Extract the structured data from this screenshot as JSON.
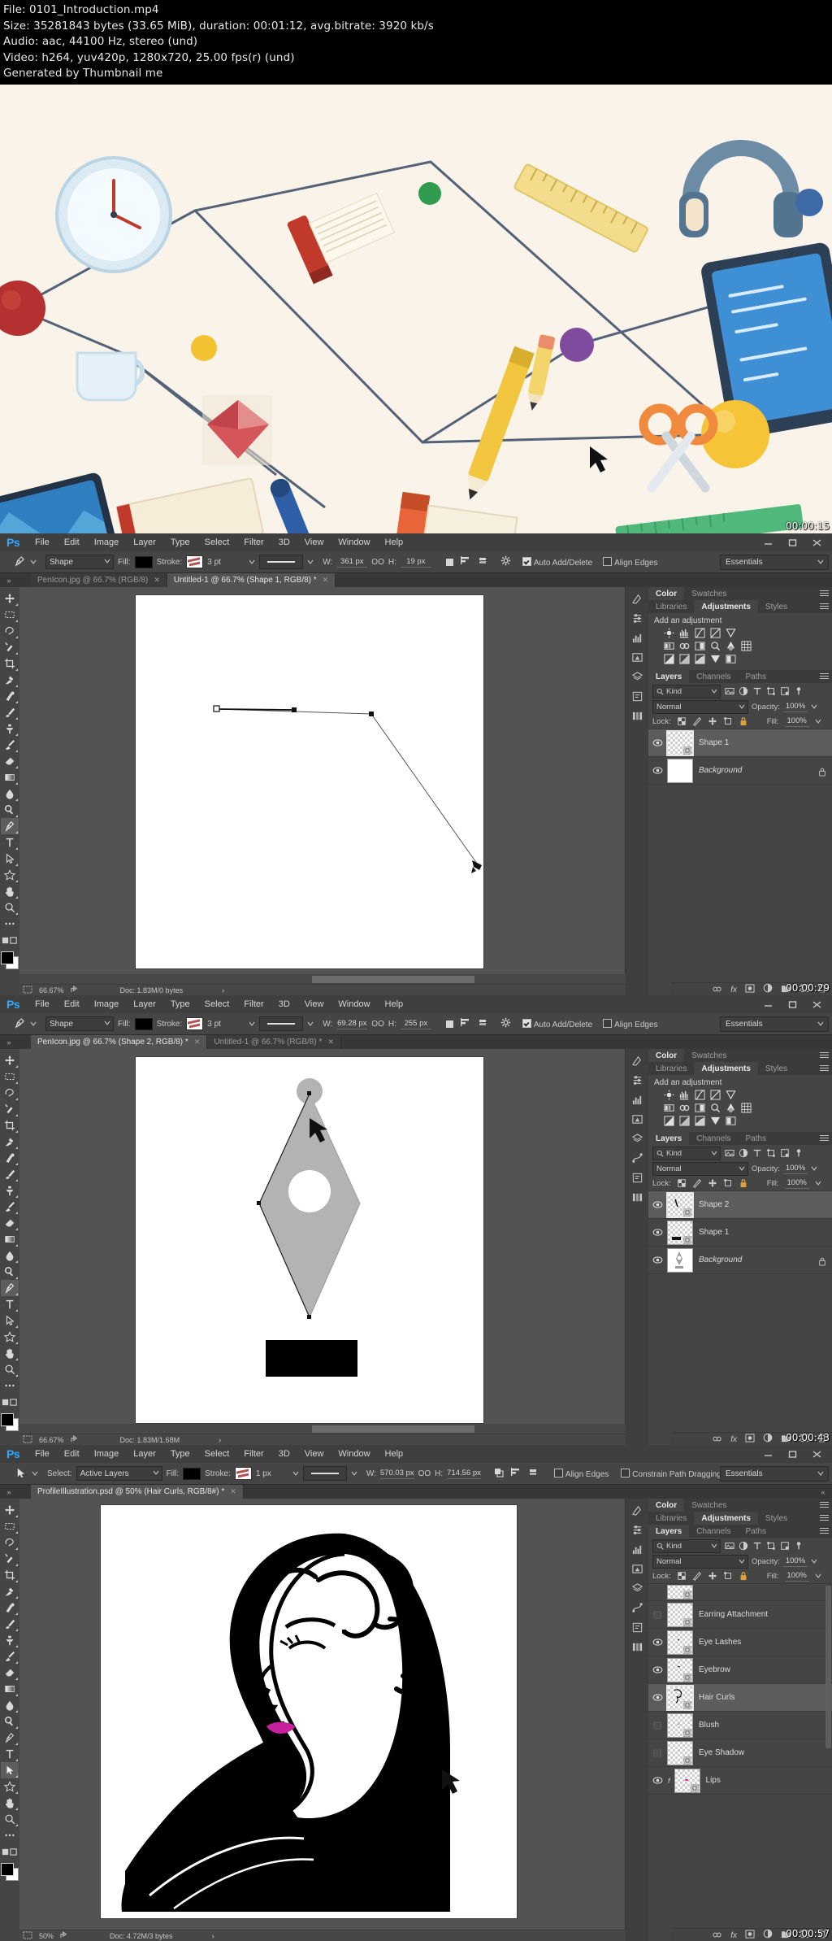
{
  "file_info": {
    "line1": "File: 0101_Introduction.mp4",
    "line2": "Size: 35281843 bytes (33.65 MiB), duration: 00:01:12, avg.bitrate: 3920 kb/s",
    "line3": "Audio: aac, 44100 Hz, stereo (und)",
    "line4": "Video: h264, yuv420p, 1280x720, 25.00 fps(r) (und)",
    "line5": "Generated by Thumbnail me"
  },
  "thumbnails": {
    "t1": "00:00:15",
    "t2": "00:00:29",
    "t3": "00:00:43",
    "t4": "00:00:57"
  },
  "menu": [
    "File",
    "Edit",
    "Image",
    "Layer",
    "Type",
    "Select",
    "Filter",
    "3D",
    "View",
    "Window",
    "Help"
  ],
  "window_controls": {
    "minimize": "minimize-icon",
    "maximize": "maximize-icon",
    "close": "close-icon"
  },
  "workspace": {
    "label": "Essentials"
  },
  "panel_tabs": {
    "row1": [
      "Color",
      "Swatches"
    ],
    "row1_active": "Color",
    "row2": [
      "Libraries",
      "Adjustments",
      "Styles"
    ],
    "row2_active": "Adjustments",
    "row3": [
      "Layers",
      "Channels",
      "Paths"
    ],
    "row3_active": "Layers"
  },
  "adjustments": {
    "title": "Add an adjustment"
  },
  "layers_ui": {
    "kind": "Kind",
    "blend_mode": "Normal",
    "opacity_label": "Opacity:",
    "opacity_value": "100%",
    "lock_label": "Lock:",
    "fill_label": "Fill:",
    "fill_value": "100%"
  },
  "windows": [
    {
      "id": "ps-window-1",
      "options": {
        "tool": "pen-tool",
        "mode": "Shape",
        "fill_label": "Fill:",
        "fill_color": "#000000",
        "stroke_label": "Stroke:",
        "stroke_width": "3 pt",
        "w_label": "W:",
        "w_value": "361 px",
        "link": "OO",
        "h_label": "H:",
        "h_value": "19 px",
        "auto_add_delete": "Auto Add/Delete",
        "auto_add_delete_checked": true,
        "align_edges": "Align Edges",
        "align_edges_checked": false
      },
      "tabs": [
        {
          "label": "PenIcon.jpg @ 66.7% (RGB/8)",
          "active": false
        },
        {
          "label": "Untitled-1 @ 66.7% (Shape 1, RGB/8) *",
          "active": true
        }
      ],
      "status": {
        "zoom": "66.67%",
        "doc": "Doc: 1.83M/0 bytes"
      },
      "layers": [
        {
          "name": "Shape 1",
          "visible": true,
          "selected": true,
          "italic": false,
          "locked": false,
          "kind": "vector-empty"
        },
        {
          "name": "Background",
          "visible": true,
          "selected": false,
          "italic": true,
          "locked": true,
          "kind": "white"
        }
      ],
      "timestamp": "00:00:29"
    },
    {
      "id": "ps-window-2",
      "options": {
        "tool": "pen-tool",
        "mode": "Shape",
        "fill_label": "Fill:",
        "fill_color": "#000000",
        "stroke_label": "Stroke:",
        "stroke_width": "3 pt",
        "w_label": "W:",
        "w_value": "69.28 px",
        "link": "OO",
        "h_label": "H:",
        "h_value": "255 px",
        "auto_add_delete": "Auto Add/Delete",
        "auto_add_delete_checked": true,
        "align_edges": "Align Edges",
        "align_edges_checked": false
      },
      "tabs": [
        {
          "label": "PenIcon.jpg @ 66.7% (Shape 2, RGB/8) *",
          "active": true
        },
        {
          "label": "Untitled-1 @ 66.7% (RGB/8) *",
          "active": false
        }
      ],
      "status": {
        "zoom": "66.67%",
        "doc": "Doc: 1.83M/1.68M"
      },
      "layers": [
        {
          "name": "Shape 2",
          "visible": true,
          "selected": true,
          "italic": false,
          "locked": false,
          "kind": "vector-stroke"
        },
        {
          "name": "Shape 1",
          "visible": true,
          "selected": false,
          "italic": false,
          "locked": false,
          "kind": "vector-bar"
        },
        {
          "name": "Background",
          "visible": true,
          "selected": false,
          "italic": true,
          "locked": true,
          "kind": "pen-nib"
        }
      ],
      "timestamp": "00:00:43"
    },
    {
      "id": "ps-window-3",
      "options": {
        "tool": "path-selection-tool",
        "select_label": "Select:",
        "select_value": "Active Layers",
        "fill_label": "Fill:",
        "fill_color": "#000000",
        "stroke_label": "Stroke:",
        "stroke_width": "1 px",
        "w_label": "W:",
        "w_value": "570.03 px",
        "link": "OO",
        "h_label": "H:",
        "h_value": "714.56 px",
        "align_edges": "Align Edges",
        "align_edges_checked": false,
        "constrain_path_dragging": "Constrain Path Dragging",
        "constrain_checked": false
      },
      "tabs": [
        {
          "label": "ProfileIllustration.psd @ 50% (Hair Curls, RGB/8#) *",
          "active": true
        }
      ],
      "status": {
        "zoom": "50%",
        "doc": "Doc: 4.72M/3 bytes"
      },
      "layers": [
        {
          "name": "",
          "visible": false,
          "selected": false,
          "italic": false,
          "locked": false,
          "kind": "vector-empty",
          "partial": true
        },
        {
          "name": "Earring Attachment",
          "visible": false,
          "selected": false,
          "italic": false,
          "locked": false,
          "kind": "vector-empty"
        },
        {
          "name": "Eye Lashes",
          "visible": true,
          "selected": false,
          "italic": false,
          "locked": false,
          "kind": "vector-empty"
        },
        {
          "name": "Eyebrow",
          "visible": true,
          "selected": false,
          "italic": false,
          "locked": false,
          "kind": "vector-empty"
        },
        {
          "name": "Hair Curls",
          "visible": true,
          "selected": true,
          "italic": false,
          "locked": false,
          "kind": "vector-curl"
        },
        {
          "name": "Blush",
          "visible": false,
          "selected": false,
          "italic": false,
          "locked": false,
          "kind": "vector-empty"
        },
        {
          "name": "Eye Shadow",
          "visible": false,
          "selected": false,
          "italic": false,
          "locked": false,
          "kind": "vector-empty"
        },
        {
          "name": "Lips",
          "visible": true,
          "selected": false,
          "italic": false,
          "locked": false,
          "kind": "vector-empty"
        }
      ],
      "timestamp": "00:00:57"
    }
  ],
  "toolbar_tools": [
    "move-tool",
    "marquee-tool",
    "lasso-tool",
    "quick-selection-tool",
    "crop-tool",
    "eyedropper-tool",
    "healing-brush-tool",
    "brush-tool",
    "clone-stamp-tool",
    "history-brush-tool",
    "eraser-tool",
    "gradient-tool",
    "blur-tool",
    "dodge-tool",
    "pen-tool",
    "type-tool",
    "path-selection-tool",
    "shape-tool",
    "hand-tool",
    "zoom-tool",
    "more-tools",
    "quick-mask-icon",
    "screen-mode-icon"
  ],
  "dock_rail_icons": [
    "color-icon",
    "adjustments-icon",
    "styles-icon",
    "histogram-icon",
    "navigator-icon",
    "layers-icon",
    "channels-icon",
    "paths-icon",
    "properties-icon",
    "libraries-icon"
  ],
  "layer_footer_icons": [
    "link-icon",
    "fx-icon",
    "mask-icon",
    "adjustment-icon",
    "group-icon",
    "new-layer-icon",
    "delete-icon"
  ],
  "colors": {
    "ps_chrome": "#535353",
    "ps_panel": "#454545",
    "ps_dark": "#3b3b3b",
    "accent_blue": "#31a8ff",
    "illustration_bg": "#faf3e9"
  }
}
